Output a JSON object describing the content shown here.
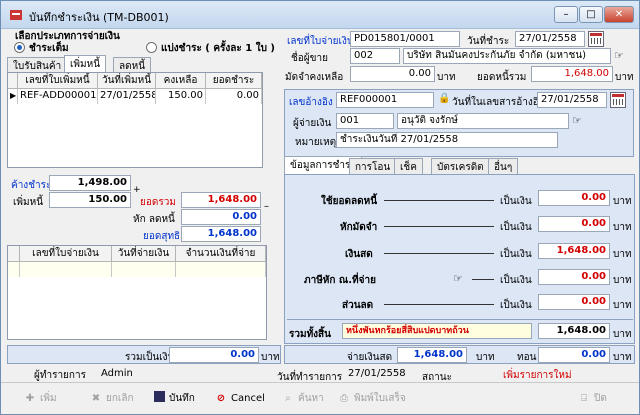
{
  "window": {
    "title": "บันทึกชำระเงิน (TM-DB001)"
  },
  "payment_mode": {
    "title": "เลือกประเภทการจ่ายเงิน",
    "full": "ชำระเต็ม",
    "installment": "แบ่งชำระ ( ครั้งละ 1 ใบ )"
  },
  "left_tabs": [
    "ใบรับสินค้า",
    "เพิ่มหนี้",
    "ลดหนี้"
  ],
  "invoice_grid": {
    "headers": [
      "เลขที่ใบเพิ่มหนี้",
      "วันที่เพิ่มหนี้",
      "คงเหลือ",
      "ยอดชำระ"
    ],
    "rows": [
      [
        "REF-ADD00001",
        "27/01/2558",
        "150.00",
        "0.00"
      ]
    ]
  },
  "summary": {
    "paid_label": "ค้างชำระ",
    "paid_value": "1,498.00",
    "add_label": "เพิ่มหนี้",
    "add_value": "150.00",
    "total_label": "ยอดรวม",
    "total_value": "1,648.00",
    "reduce_label": "หัก ลดหนี้",
    "reduce_value": "0.00",
    "net_label": "ยอดสุทธิ",
    "net_value": "1,648.00"
  },
  "cheque_grid": {
    "headers": [
      "เลขที่ใบจ่ายเงิน",
      "วันที่จ่ายเงิน",
      "จำนวนเงินที่จ่าย"
    ]
  },
  "header": {
    "doc_no_label": "เลขที่ใบจ่ายเงิน",
    "doc_no": "PD015801/0001",
    "date_label": "วันที่ชำระ",
    "date": "27/01/2558",
    "vendor_label": "ชื่อผู้ขาย",
    "vendor_code": "002",
    "vendor_name": "บริษัท สินมั่นคงประกันภัย จำกัด (มหาชน)",
    "deposit_label": "มัดจำคงเหลือ",
    "deposit": "0.00",
    "deposit_unit": "บาท",
    "total_label": "ยอดหนี้รวม",
    "total": "1,648.00",
    "total_unit": "บาท"
  },
  "ref": {
    "ref_label": "เลขอ้างอิง",
    "ref_no": "REF000001",
    "ref_date_label": "วันที่ในเลขสารอ้างอิง",
    "ref_date": "27/01/2558",
    "payer_label": "ผู้จ่ายเงิน",
    "payer_code": "001",
    "payer_name": "อนุวัติ จงรักษ์",
    "note_label": "หมายเหตุ",
    "note": "ชำระเงินวันที่ 27/01/2558"
  },
  "right_tabs": [
    "ข้อมูลการชำระ",
    "การโอน",
    "เช็ค",
    "บัตรเครดิต",
    "อื่นๆ"
  ],
  "payment_rows": [
    {
      "label": "ใช้ยอดลดหนี้",
      "unit_label": "เป็นเงิน",
      "value": "0.00",
      "unit": "บาท"
    },
    {
      "label": "หักมัดจำ",
      "unit_label": "เป็นเงิน",
      "value": "0.00",
      "unit": "บาท"
    },
    {
      "label": "เงินสด",
      "unit_label": "เป็นเงิน",
      "value": "1,648.00",
      "unit": "บาท"
    },
    {
      "label": "ภาษีหัก ณ.ที่จ่าย",
      "unit_label": "เป็นเงิน",
      "value": "0.00",
      "unit": "บาท"
    },
    {
      "label": "ส่วนลด",
      "unit_label": "เป็นเงิน",
      "value": "0.00",
      "unit": "บาท"
    }
  ],
  "grand_total": {
    "label": "รวมทั้งสิ้น",
    "text": "หนึ่งพันหกร้อยสี่สิบแปดบาทถ้วน",
    "value": "1,648.00",
    "unit": "บาท"
  },
  "bottom": {
    "sum_label": "รวมเป็นเงิน",
    "sum_value": "0.00",
    "sum_unit": "บาท",
    "cash_label": "จ่ายเงินสด",
    "cash_value": "1,648.00",
    "cash_unit": "บาท",
    "change_label": "ทอน",
    "change_value": "0.00",
    "change_unit": "บาท",
    "user_label": "ผู้ทำรายการ",
    "user": "Admin",
    "txdate_label": "วันที่ทำรายการ",
    "txdate": "27/01/2558",
    "status_label": "สถานะ",
    "status": "เพิ่มรายการใหม่"
  },
  "toolbar": {
    "add": "เพิ่ม",
    "undo": "ยกเลิก",
    "save": "บันทึก",
    "cancel": "Cancel",
    "search": "ค้นหา",
    "print": "พิมพ์ใบเสร็จ",
    "close": "ปิด"
  },
  "colors": {
    "accent_blue": "#0033cc",
    "red_value": "#d40000",
    "panel_bg": "#dce6f5"
  }
}
